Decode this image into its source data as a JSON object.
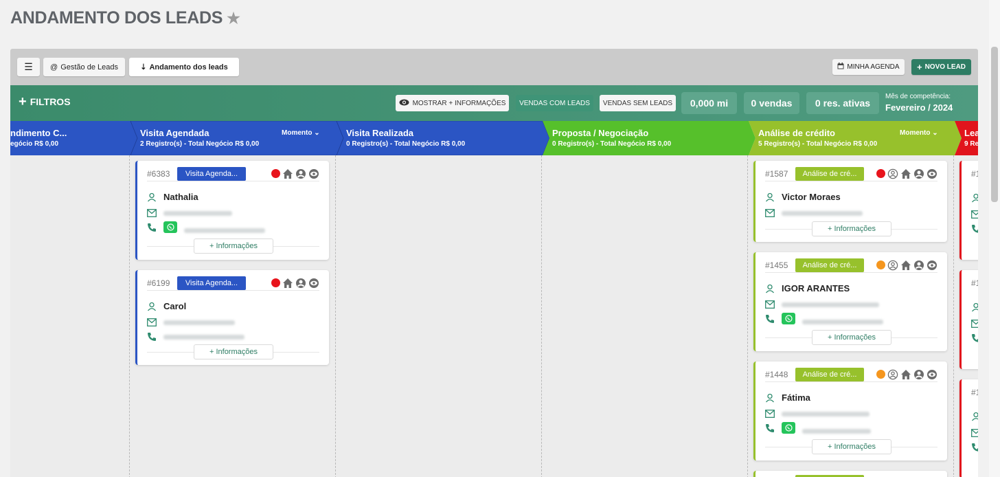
{
  "page": {
    "title": "ANDAMENTO DOS LEADS"
  },
  "toolbar": {
    "menu_icon": "hamburger-icon",
    "tab_gestao": "Gestão de Leads",
    "tab_andamento": "Andamento dos leads",
    "minha_agenda": "MINHA AGENDA",
    "novo_lead": "NOVO LEAD"
  },
  "filters": {
    "label": "FILTROS",
    "mostrar": "MOSTRAR + INFORMAÇÕES",
    "com_leads": "VENDAS COM LEADS",
    "sem_leads": "VENDAS SEM LEADS",
    "stat_mi": "0,000 mi",
    "stat_vendas": "0 vendas",
    "stat_res": "0 res. ativas",
    "competencia_label": "Mês de competência:",
    "competencia_value": "Fevereiro / 2024"
  },
  "stages": [
    {
      "name": "Atendimento C...",
      "visible_name": "ndimento C...",
      "sub": "egócio R$ 0,00",
      "color": "#2b55c4"
    },
    {
      "name": "Visita Agendada",
      "sub": "2 Registro(s) - Total Negócio R$ 0,00",
      "momento": "Momento",
      "color": "#2b55c4"
    },
    {
      "name": "Visita Realizada",
      "sub": "0 Registro(s) - Total Negócio R$ 0,00",
      "color": "#2b55c4"
    },
    {
      "name": "Proposta / Negociação",
      "sub": "0 Registro(s) - Total Negócio R$ 0,00",
      "color": "#56c02b"
    },
    {
      "name": "Análise de crédito",
      "sub": "5 Registro(s) - Total Negócio R$ 0,00",
      "momento": "Momento",
      "color": "#97c12c"
    },
    {
      "name": "Lea",
      "sub": "9 Re",
      "color": "#e1141c"
    }
  ],
  "colors": {
    "blue": "#2b55c4",
    "green_stage": "#56c02b",
    "lime": "#97c12c",
    "red": "#e1141c",
    "accent": "#2e7d64",
    "dot_red": "#e8141c",
    "dot_orange": "#f5961e"
  },
  "cards": {
    "c6383": {
      "id": "#6383",
      "tag": "Visita Agenda...",
      "name": "Nathalia",
      "info": "+ Informações"
    },
    "c6199": {
      "id": "#6199",
      "tag": "Visita Agenda...",
      "name": "Carol",
      "info": "+ Informações"
    },
    "c1587": {
      "id": "#1587",
      "tag": "Análise de cré...",
      "name": "Victor Moraes",
      "info": "+ Informações"
    },
    "c1455": {
      "id": "#1455",
      "tag": "Análise de cré...",
      "name": "IGOR ARANTES",
      "info": "+ Informações"
    },
    "c1448": {
      "id": "#1448",
      "tag": "Análise de cré...",
      "name": "Fátima",
      "info": "+ Informações"
    }
  },
  "red_partial_ids": [
    "#1",
    "#1",
    "#1"
  ]
}
